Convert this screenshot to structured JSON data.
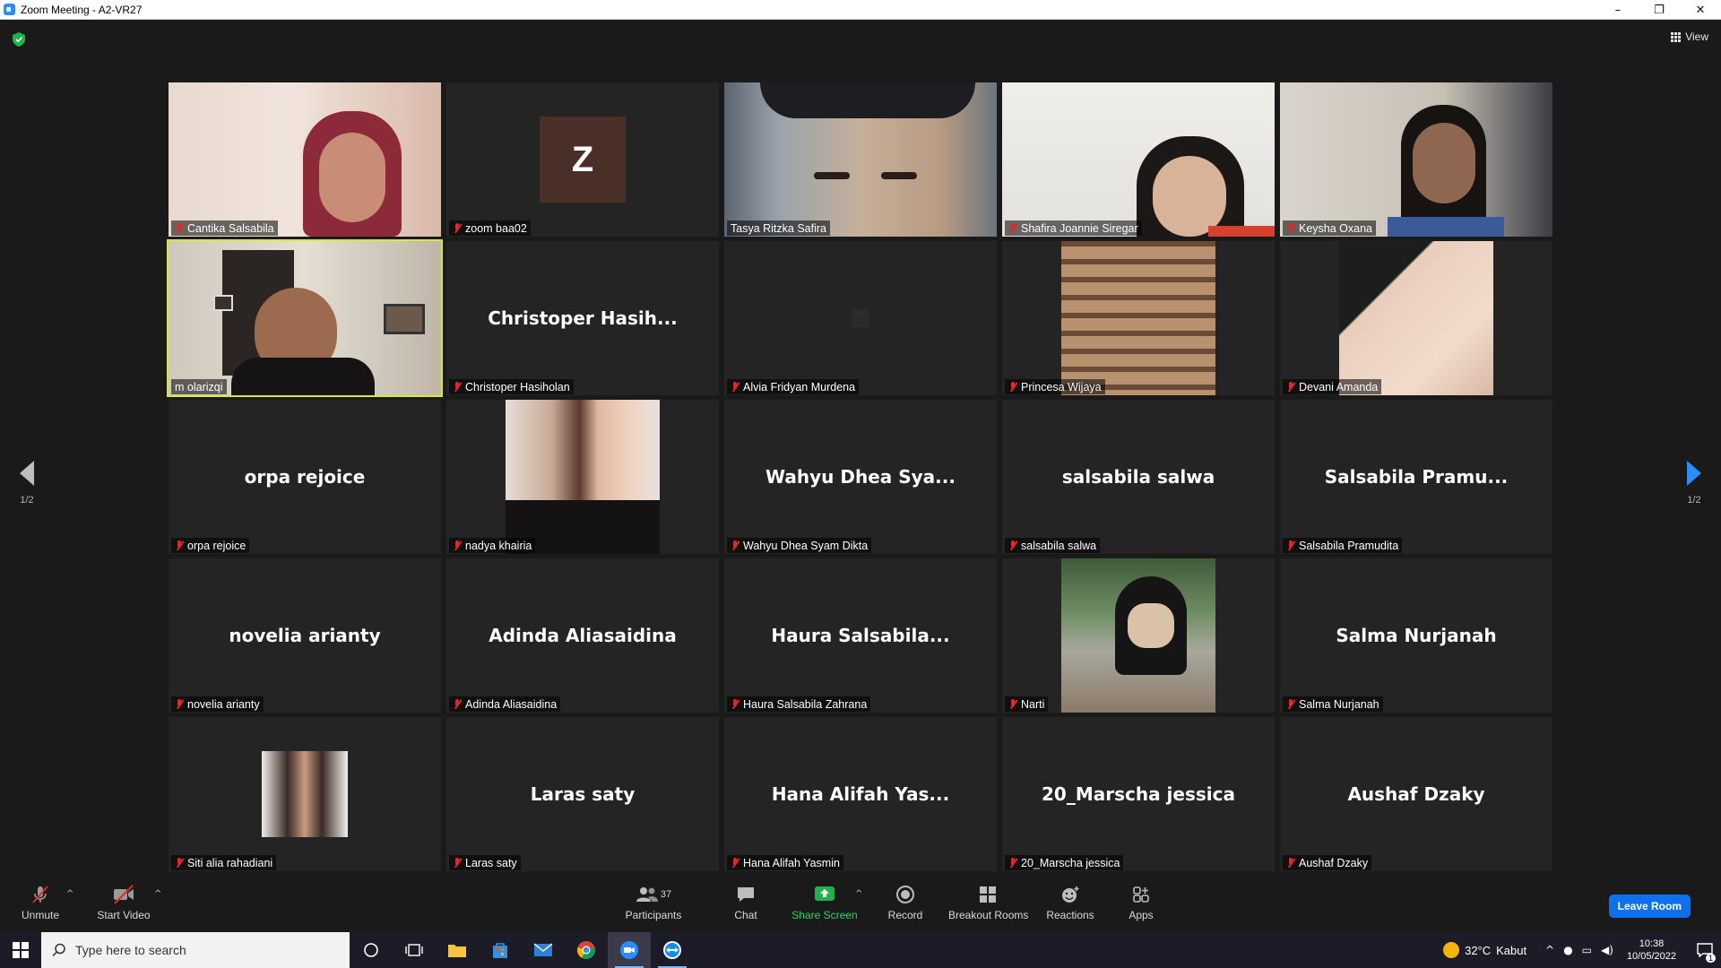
{
  "window": {
    "title": "Zoom Meeting - A2-VR27",
    "minimize": "–",
    "restore": "❐",
    "close": "✕"
  },
  "meeting": {
    "view_label": "View",
    "page_indicator_left": "1/2",
    "page_indicator_right": "1/2"
  },
  "tiles": [
    {
      "name": "Cantika Salsabila",
      "muted": true,
      "kind": "video"
    },
    {
      "name": "zoom baa02",
      "muted": true,
      "kind": "avatar",
      "avatar_letter": "Z"
    },
    {
      "name": "Tasya Ritzka Safira",
      "muted": false,
      "kind": "video"
    },
    {
      "name": "Shafira Joannie Siregar",
      "muted": true,
      "kind": "video"
    },
    {
      "name": "Keysha Oxana",
      "muted": true,
      "kind": "video"
    },
    {
      "name": "m olarizqi",
      "muted": false,
      "kind": "video",
      "active_speaker": true
    },
    {
      "name": "Christoper Hasiholan",
      "muted": true,
      "kind": "name",
      "display": "Christoper  Hasih..."
    },
    {
      "name": "Alvia Fridyan Murdena",
      "muted": true,
      "kind": "dark"
    },
    {
      "name": "Princesa Wijaya",
      "muted": true,
      "kind": "photo"
    },
    {
      "name": "Devani Amanda",
      "muted": true,
      "kind": "photo"
    },
    {
      "name": "orpa rejoice",
      "muted": true,
      "kind": "name",
      "display": "orpa rejoice"
    },
    {
      "name": "nadya khairia",
      "muted": true,
      "kind": "photo"
    },
    {
      "name": "Wahyu Dhea Syam Dikta",
      "muted": true,
      "kind": "name",
      "display": "Wahyu  Dhea  Sya..."
    },
    {
      "name": "salsabila salwa",
      "muted": true,
      "kind": "name",
      "display": "salsabila salwa"
    },
    {
      "name": "Salsabila Pramudita",
      "muted": true,
      "kind": "name",
      "display": "Salsabila  Pramu..."
    },
    {
      "name": "novelia arianty",
      "muted": true,
      "kind": "name",
      "display": "novelia arianty"
    },
    {
      "name": "Adinda Aliasaidina",
      "muted": true,
      "kind": "name",
      "display": "Adinda  Aliasaidina"
    },
    {
      "name": "Haura Salsabila Zahrana",
      "muted": true,
      "kind": "name",
      "display": "Haura  Salsabila..."
    },
    {
      "name": "Narti",
      "muted": true,
      "kind": "photo"
    },
    {
      "name": "Salma Nurjanah",
      "muted": true,
      "kind": "name",
      "display": "Salma  Nurjanah"
    },
    {
      "name": "Siti alia rahadiani",
      "muted": true,
      "kind": "photo-small"
    },
    {
      "name": "Laras saty",
      "muted": true,
      "kind": "name",
      "display": "Laras saty"
    },
    {
      "name": "Hana Alifah Yasmin",
      "muted": true,
      "kind": "name",
      "display": "Hana  Alifah  Yas..."
    },
    {
      "name": "20_Marscha jessica",
      "muted": true,
      "kind": "name",
      "display": "20_Marscha jessica"
    },
    {
      "name": "Aushaf Dzaky",
      "muted": true,
      "kind": "name",
      "display": "Aushaf  Dzaky"
    }
  ],
  "toolbar": {
    "unmute": "Unmute",
    "start_video": "Start Video",
    "participants": "Participants",
    "participants_count": "37",
    "chat": "Chat",
    "share_screen": "Share Screen",
    "record": "Record",
    "breakout_rooms": "Breakout Rooms",
    "reactions": "Reactions",
    "apps": "Apps",
    "leave_room": "Leave Room"
  },
  "taskbar": {
    "search_placeholder": "Type here to search",
    "temperature": "32°C",
    "weather": "Kabut",
    "time": "10:38",
    "date": "10/05/2022",
    "notification_count": "1"
  },
  "colors": {
    "active_speaker_border": "#d8e83a",
    "muted_red": "#e02828",
    "share_green": "#2bd46b",
    "leave_blue": "#0e71eb"
  }
}
